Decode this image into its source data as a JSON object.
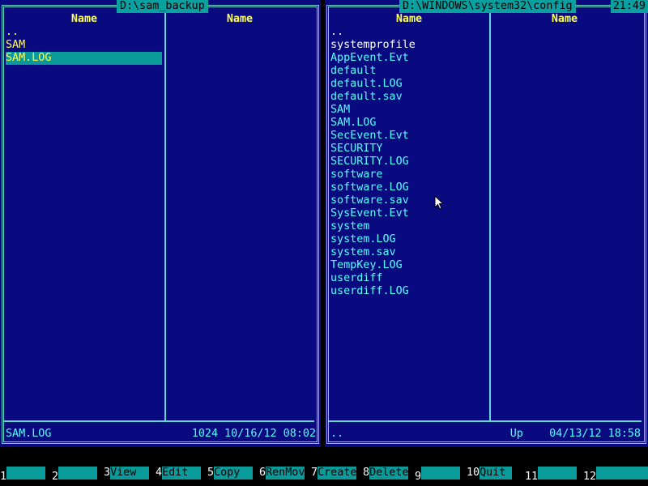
{
  "left_panel": {
    "path": "D:\\sam_backup",
    "col1_header": "Name",
    "col2_header": "Name",
    "items": [
      {
        "name": ".."
      },
      {
        "name": "SAM"
      },
      {
        "name": "SAM.LOG"
      }
    ],
    "status_name": "SAM.LOG",
    "status_info": "1024 10/16/12 08:02"
  },
  "right_panel": {
    "path": "D:\\WINDOWS\\system32\\config",
    "col1_header": "Name",
    "col2_header": "Name",
    "items": [
      {
        "name": ".."
      },
      {
        "name": "systemprofile"
      },
      {
        "name": "AppEvent.Evt"
      },
      {
        "name": "default"
      },
      {
        "name": "default.LOG"
      },
      {
        "name": "default.sav"
      },
      {
        "name": "SAM"
      },
      {
        "name": "SAM.LOG"
      },
      {
        "name": "SecEvent.Evt"
      },
      {
        "name": "SECURITY"
      },
      {
        "name": "SECURITY.LOG"
      },
      {
        "name": "software"
      },
      {
        "name": "software.LOG"
      },
      {
        "name": "software.sav"
      },
      {
        "name": "SysEvent.Evt"
      },
      {
        "name": "system"
      },
      {
        "name": "system.LOG"
      },
      {
        "name": "system.sav"
      },
      {
        "name": "TempKey.LOG"
      },
      {
        "name": "userdiff"
      },
      {
        "name": "userdiff.LOG"
      }
    ],
    "status_name": "..",
    "status_info": "Up    04/13/12 18:58"
  },
  "clock": "21:49",
  "fkeys": [
    {
      "num": "1",
      "label": ""
    },
    {
      "num": "2",
      "label": ""
    },
    {
      "num": "3",
      "label": "View"
    },
    {
      "num": "4",
      "label": "Edit"
    },
    {
      "num": "5",
      "label": "Copy"
    },
    {
      "num": "6",
      "label": "RenMov"
    },
    {
      "num": "7",
      "label": "Create"
    },
    {
      "num": "8",
      "label": "Delete"
    },
    {
      "num": "9",
      "label": ""
    },
    {
      "num": "10",
      "label": "Quit"
    },
    {
      "num": "11",
      "label": ""
    },
    {
      "num": "12",
      "label": ""
    }
  ]
}
